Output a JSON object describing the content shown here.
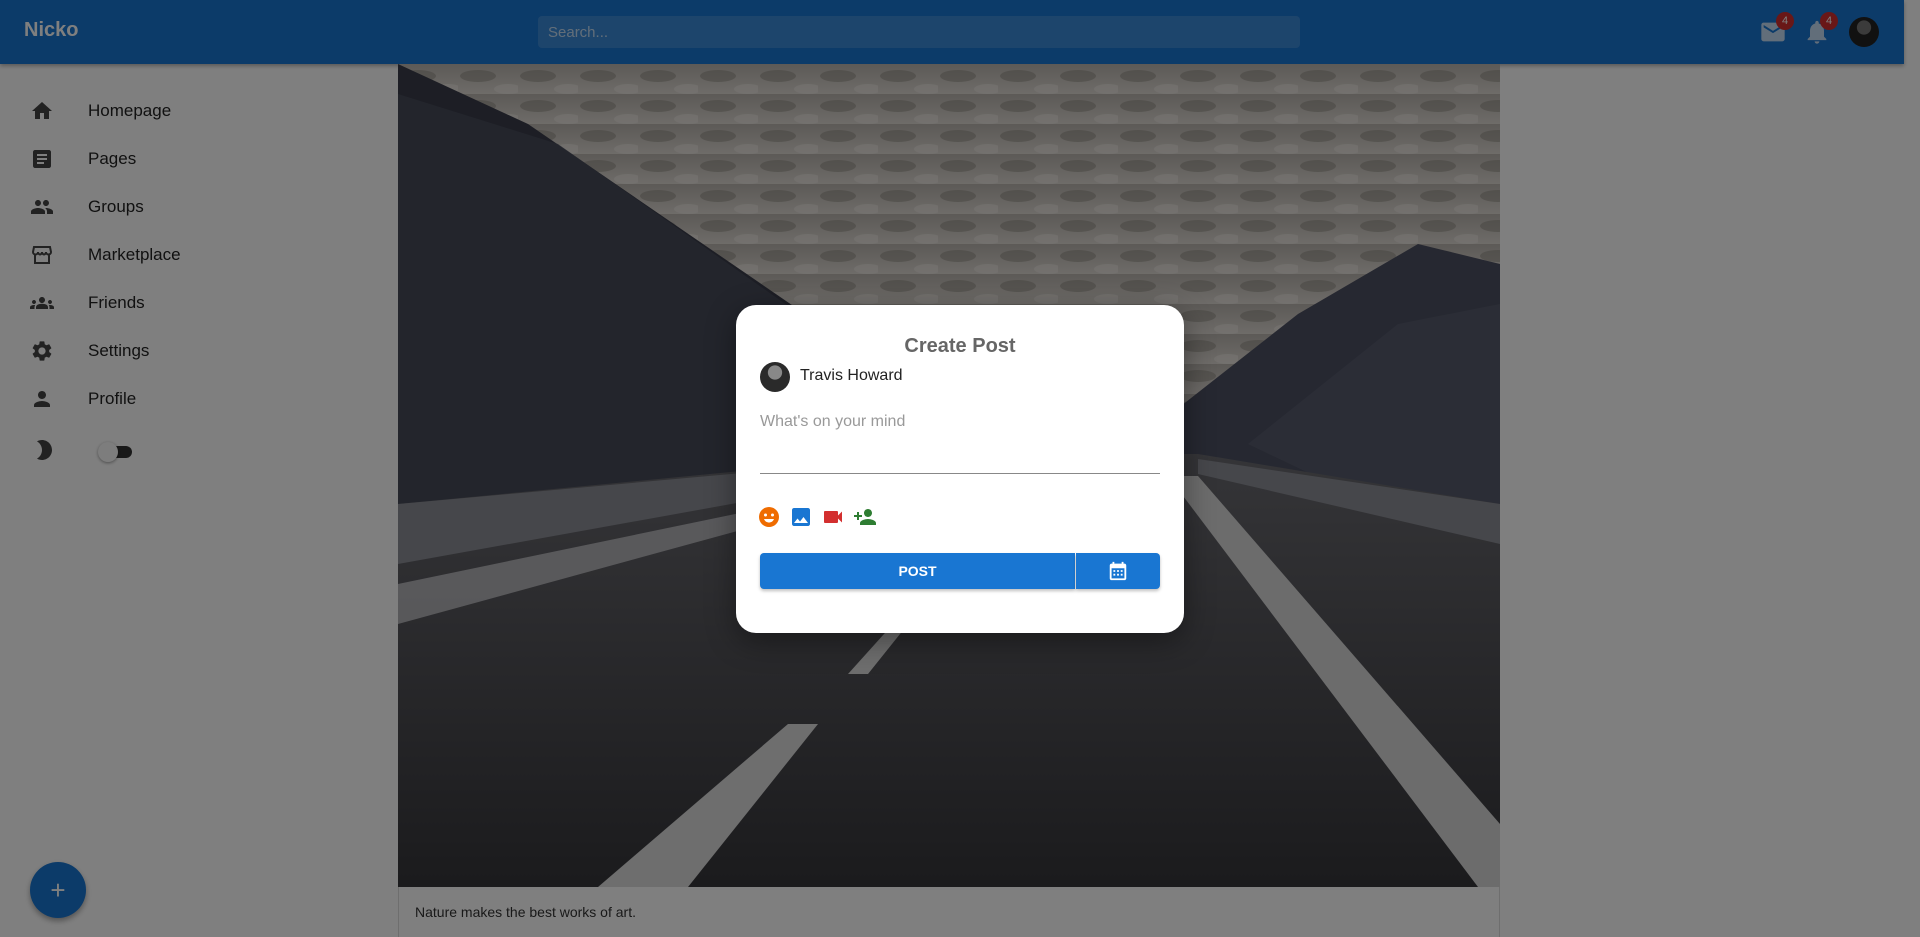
{
  "app": {
    "logo": "Nicko"
  },
  "header": {
    "search_placeholder": "Search...",
    "mail_badge": "4",
    "notification_badge": "4"
  },
  "sidebar": {
    "items": [
      {
        "label": "Homepage",
        "icon": "home-icon"
      },
      {
        "label": "Pages",
        "icon": "article-icon"
      },
      {
        "label": "Groups",
        "icon": "group-icon"
      },
      {
        "label": "Marketplace",
        "icon": "storefront-icon"
      },
      {
        "label": "Friends",
        "icon": "people-icon"
      },
      {
        "label": "Settings",
        "icon": "gear-icon"
      },
      {
        "label": "Profile",
        "icon": "person-icon"
      }
    ],
    "theme_toggle_icon": "moon-icon"
  },
  "feed": {
    "caption": "Nature makes the best works of art."
  },
  "fab": {
    "label": "+"
  },
  "modal": {
    "title": "Create Post",
    "user_name": "Travis Howard",
    "input_placeholder": "What's on your mind",
    "post_label": "POST",
    "colors": {
      "emoji": "#ef6c00",
      "image": "#1976d2",
      "video": "#d32f2f",
      "tag": "#2e7d32"
    }
  },
  "colors": {
    "primary": "#1976d2",
    "badge": "#d32f2f"
  }
}
